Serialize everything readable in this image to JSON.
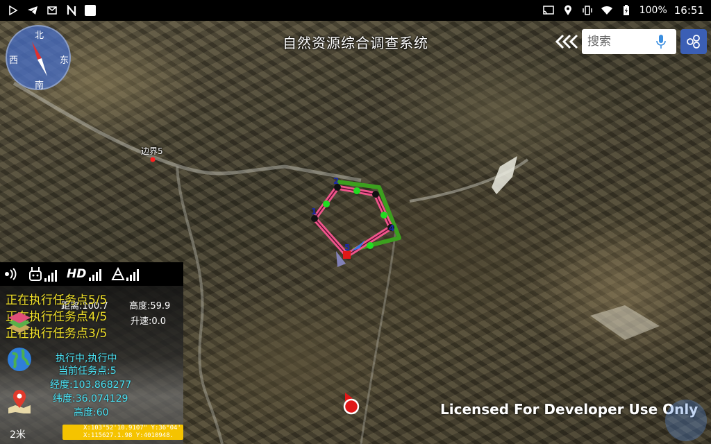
{
  "app": {
    "title": "自然资源综合调查系统",
    "license_text": "Licensed For Developer Use Only"
  },
  "status_bar": {
    "left_icons": [
      "play-store-icon",
      "telegram-icon",
      "mail-icon",
      "n-icon",
      "square-icon"
    ],
    "right_icons": [
      "cast-icon",
      "location-icon",
      "vibrate-icon",
      "wifi-icon",
      "battery-icon"
    ],
    "battery": "100%",
    "time": "16:51"
  },
  "compass": {
    "north": "北",
    "south": "南",
    "west": "西",
    "east": "东"
  },
  "search": {
    "placeholder": "搜索"
  },
  "map": {
    "marker_label": "边界5",
    "waypoints": [
      "1",
      "2",
      "3",
      "4",
      "5"
    ]
  },
  "panel": {
    "tasks": [
      "正在执行任务点5/5",
      "正在执行任务点4/5",
      "正在执行任务点3/5"
    ],
    "distance": "距离:100.7",
    "altitude": "高度:59.9",
    "climb": "升速:0.0",
    "state": "执行中,执行中",
    "current_point": "当前任务点:5",
    "longitude": "经度:103.868277",
    "latitude": "纬度:36.074129",
    "height": "高度:60",
    "scale": "2米",
    "coord_x": "X:103°52'10.9107\" Y:36°04'",
    "coord_y": "X:115627.1.98 Y:4010948."
  },
  "colors": {
    "route_pink": "#f0558c",
    "route_green": "#3ca01e",
    "task_text": "#f1e12a",
    "status_cyan": "#4be3f5",
    "compass_blue": "#466ec8"
  }
}
